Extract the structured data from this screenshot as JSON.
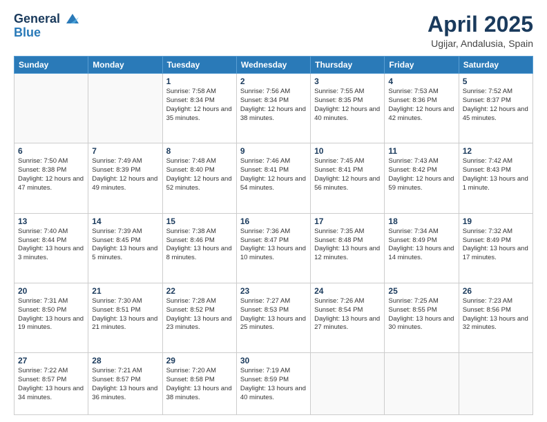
{
  "header": {
    "logo_line1": "General",
    "logo_line2": "Blue",
    "title": "April 2025",
    "subtitle": "Ugijar, Andalusia, Spain"
  },
  "weekdays": [
    "Sunday",
    "Monday",
    "Tuesday",
    "Wednesday",
    "Thursday",
    "Friday",
    "Saturday"
  ],
  "weeks": [
    [
      {
        "day": "",
        "info": ""
      },
      {
        "day": "",
        "info": ""
      },
      {
        "day": "1",
        "info": "Sunrise: 7:58 AM\nSunset: 8:34 PM\nDaylight: 12 hours and 35 minutes."
      },
      {
        "day": "2",
        "info": "Sunrise: 7:56 AM\nSunset: 8:34 PM\nDaylight: 12 hours and 38 minutes."
      },
      {
        "day": "3",
        "info": "Sunrise: 7:55 AM\nSunset: 8:35 PM\nDaylight: 12 hours and 40 minutes."
      },
      {
        "day": "4",
        "info": "Sunrise: 7:53 AM\nSunset: 8:36 PM\nDaylight: 12 hours and 42 minutes."
      },
      {
        "day": "5",
        "info": "Sunrise: 7:52 AM\nSunset: 8:37 PM\nDaylight: 12 hours and 45 minutes."
      }
    ],
    [
      {
        "day": "6",
        "info": "Sunrise: 7:50 AM\nSunset: 8:38 PM\nDaylight: 12 hours and 47 minutes."
      },
      {
        "day": "7",
        "info": "Sunrise: 7:49 AM\nSunset: 8:39 PM\nDaylight: 12 hours and 49 minutes."
      },
      {
        "day": "8",
        "info": "Sunrise: 7:48 AM\nSunset: 8:40 PM\nDaylight: 12 hours and 52 minutes."
      },
      {
        "day": "9",
        "info": "Sunrise: 7:46 AM\nSunset: 8:41 PM\nDaylight: 12 hours and 54 minutes."
      },
      {
        "day": "10",
        "info": "Sunrise: 7:45 AM\nSunset: 8:41 PM\nDaylight: 12 hours and 56 minutes."
      },
      {
        "day": "11",
        "info": "Sunrise: 7:43 AM\nSunset: 8:42 PM\nDaylight: 12 hours and 59 minutes."
      },
      {
        "day": "12",
        "info": "Sunrise: 7:42 AM\nSunset: 8:43 PM\nDaylight: 13 hours and 1 minute."
      }
    ],
    [
      {
        "day": "13",
        "info": "Sunrise: 7:40 AM\nSunset: 8:44 PM\nDaylight: 13 hours and 3 minutes."
      },
      {
        "day": "14",
        "info": "Sunrise: 7:39 AM\nSunset: 8:45 PM\nDaylight: 13 hours and 5 minutes."
      },
      {
        "day": "15",
        "info": "Sunrise: 7:38 AM\nSunset: 8:46 PM\nDaylight: 13 hours and 8 minutes."
      },
      {
        "day": "16",
        "info": "Sunrise: 7:36 AM\nSunset: 8:47 PM\nDaylight: 13 hours and 10 minutes."
      },
      {
        "day": "17",
        "info": "Sunrise: 7:35 AM\nSunset: 8:48 PM\nDaylight: 13 hours and 12 minutes."
      },
      {
        "day": "18",
        "info": "Sunrise: 7:34 AM\nSunset: 8:49 PM\nDaylight: 13 hours and 14 minutes."
      },
      {
        "day": "19",
        "info": "Sunrise: 7:32 AM\nSunset: 8:49 PM\nDaylight: 13 hours and 17 minutes."
      }
    ],
    [
      {
        "day": "20",
        "info": "Sunrise: 7:31 AM\nSunset: 8:50 PM\nDaylight: 13 hours and 19 minutes."
      },
      {
        "day": "21",
        "info": "Sunrise: 7:30 AM\nSunset: 8:51 PM\nDaylight: 13 hours and 21 minutes."
      },
      {
        "day": "22",
        "info": "Sunrise: 7:28 AM\nSunset: 8:52 PM\nDaylight: 13 hours and 23 minutes."
      },
      {
        "day": "23",
        "info": "Sunrise: 7:27 AM\nSunset: 8:53 PM\nDaylight: 13 hours and 25 minutes."
      },
      {
        "day": "24",
        "info": "Sunrise: 7:26 AM\nSunset: 8:54 PM\nDaylight: 13 hours and 27 minutes."
      },
      {
        "day": "25",
        "info": "Sunrise: 7:25 AM\nSunset: 8:55 PM\nDaylight: 13 hours and 30 minutes."
      },
      {
        "day": "26",
        "info": "Sunrise: 7:23 AM\nSunset: 8:56 PM\nDaylight: 13 hours and 32 minutes."
      }
    ],
    [
      {
        "day": "27",
        "info": "Sunrise: 7:22 AM\nSunset: 8:57 PM\nDaylight: 13 hours and 34 minutes."
      },
      {
        "day": "28",
        "info": "Sunrise: 7:21 AM\nSunset: 8:57 PM\nDaylight: 13 hours and 36 minutes."
      },
      {
        "day": "29",
        "info": "Sunrise: 7:20 AM\nSunset: 8:58 PM\nDaylight: 13 hours and 38 minutes."
      },
      {
        "day": "30",
        "info": "Sunrise: 7:19 AM\nSunset: 8:59 PM\nDaylight: 13 hours and 40 minutes."
      },
      {
        "day": "",
        "info": ""
      },
      {
        "day": "",
        "info": ""
      },
      {
        "day": "",
        "info": ""
      }
    ]
  ]
}
